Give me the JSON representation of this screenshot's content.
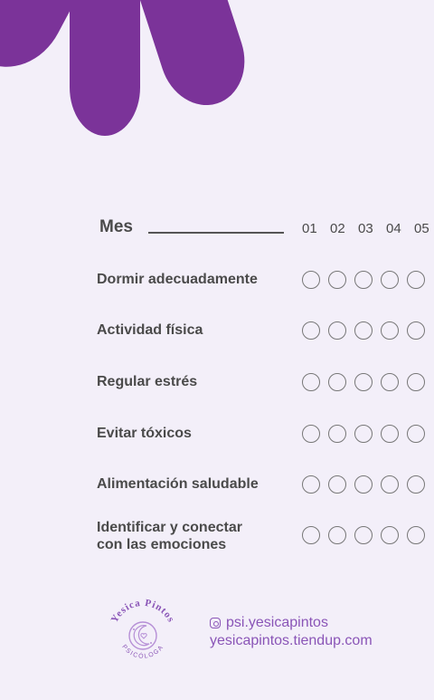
{
  "header": {
    "month_label": "Mes",
    "days": [
      "01",
      "02",
      "03",
      "04",
      "05"
    ]
  },
  "habits": [
    {
      "label": "Dormir adecuadamente"
    },
    {
      "label": "Actividad física"
    },
    {
      "label": "Regular estrés"
    },
    {
      "label": "Evitar tóxicos"
    },
    {
      "label": "Alimentación saludable"
    },
    {
      "label_line1": "Identificar y conectar",
      "label_line2": "con las emociones"
    }
  ],
  "footer": {
    "logo_name": "Yesica Pintos",
    "logo_subtitle": "PSICÓLOGA",
    "instagram": "psi.yesicapintos",
    "website": "yesicapintos.tiendup.com",
    "icon": "instagram-icon"
  },
  "colors": {
    "accent": "#7b3399",
    "text": "#4a4a4a",
    "link": "#8a55b7",
    "background": "#f3eff9"
  }
}
